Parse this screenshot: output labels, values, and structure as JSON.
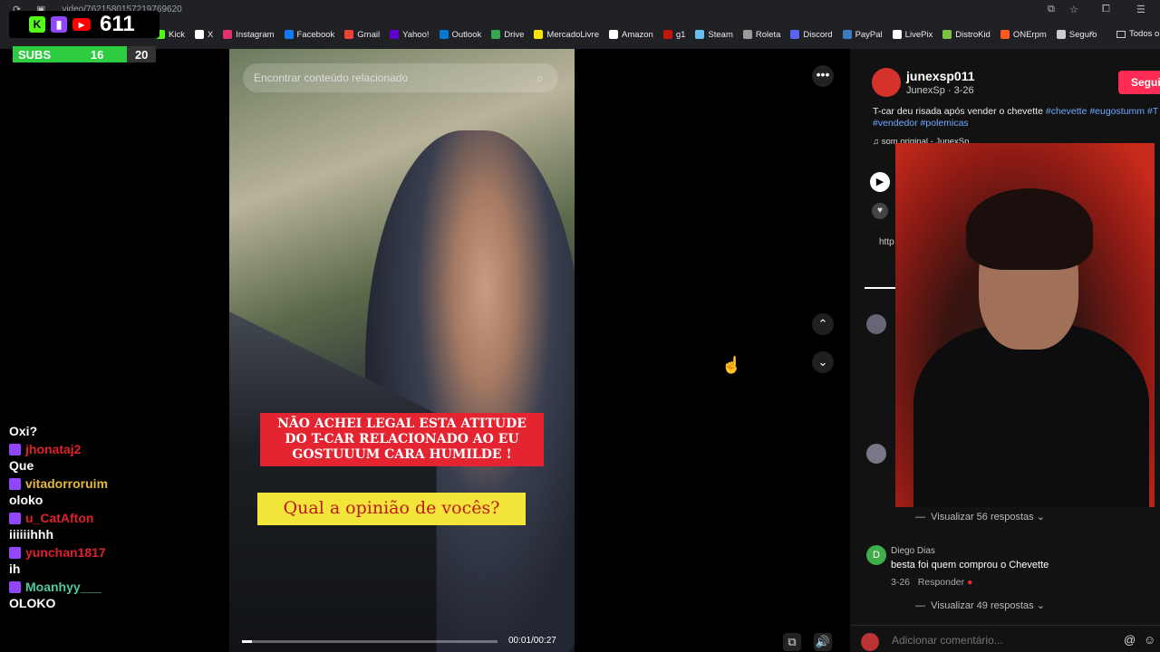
{
  "browser": {
    "url": "...video/7621580157219769620",
    "bookmarks": [
      {
        "label": "Kick",
        "color": "#53fc18"
      },
      {
        "label": "X",
        "color": "#ffffff"
      },
      {
        "label": "Instagram",
        "color": "#e1306c"
      },
      {
        "label": "Facebook",
        "color": "#1877f2"
      },
      {
        "label": "Gmail",
        "color": "#ea4335"
      },
      {
        "label": "Yahoo!",
        "color": "#6001d2"
      },
      {
        "label": "Outlook",
        "color": "#0078d4"
      },
      {
        "label": "Drive",
        "color": "#34a853"
      },
      {
        "label": "MercadoLivre",
        "color": "#ffe600"
      },
      {
        "label": "Amazon",
        "color": "#ffffff"
      },
      {
        "label": "g1",
        "color": "#c4170c"
      },
      {
        "label": "Steam",
        "color": "#66c0f4"
      },
      {
        "label": "Roleta",
        "color": "#9b9b9b"
      },
      {
        "label": "Discord",
        "color": "#5865f2"
      },
      {
        "label": "PayPal",
        "color": "#3b7bbf"
      },
      {
        "label": "LivePix",
        "color": "#ffffff"
      },
      {
        "label": "DistroKid",
        "color": "#7cc242"
      },
      {
        "label": "ONErpm",
        "color": "#ff5a1f"
      },
      {
        "label": "Seguro",
        "color": "#cccccc"
      }
    ],
    "all_bookmarks": "Todos o"
  },
  "overlay": {
    "viewers": "611",
    "subs_label": "SUBS",
    "subs_current": "16",
    "subs_goal": "20",
    "subs_progress": 0.8
  },
  "chat": [
    {
      "user": "",
      "text": "Oxi?",
      "color": "#ffffff"
    },
    {
      "user": "jhonataj2",
      "text": "Que",
      "color": "#e0202a"
    },
    {
      "user": "vitadorroruim",
      "text": "oloko",
      "color": "#e8b838"
    },
    {
      "user": "u_CatAfton",
      "text": "iiiiiihhh",
      "color": "#e0202a"
    },
    {
      "user": "yunchan1817",
      "text": "ih",
      "color": "#e0202a"
    },
    {
      "user": "Moanhyy___",
      "text": "OLOKO",
      "color": "#4ec9a0"
    }
  ],
  "video": {
    "search_placeholder": "Encontrar conteúdo relacionado",
    "caption_red": "NÃO ACHEI LEGAL ESTA ATITUDE DO T-CAR RELACIONADO AO EU GOSTUUUM CARA HUMILDE !",
    "caption_yellow": "Qual a opinião de vocês?",
    "time": "00:01/00:27",
    "progress": 0.04
  },
  "panel": {
    "username": "junexsp011",
    "subline": "JunexSp · 3-26",
    "follow": "Segui",
    "desc_text": "T-car deu risada após vender o chevette ",
    "tags": [
      "#chevette",
      "#eugostumm",
      "#T"
    ],
    "tags2": [
      "#vendedor",
      "#polemicas"
    ],
    "sound": "♫ som original - JunexSp",
    "link_text": "http",
    "replies1": "Visualizar 56 respostas",
    "comment_name": "Diego Dias",
    "comment_text": "besta foi quem comprou o Chevette",
    "comment_date": "3-26",
    "comment_reply": "Responder",
    "replies2": "Visualizar 49 respostas",
    "add_comment": "Adicionar comentário..."
  },
  "colors": {
    "tiktok_red": "#fe2c55",
    "twitch": "#9146ff",
    "kick": "#53fc18",
    "youtube": "#ff0000"
  }
}
